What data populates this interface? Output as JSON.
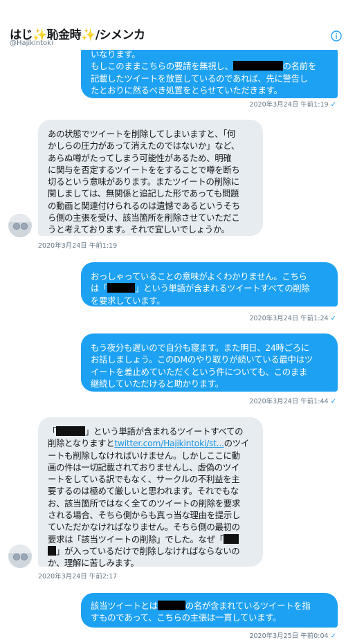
{
  "header": {
    "title": "はじ✨恥金時✨/シメンカ",
    "handle": "@Hajikintoki",
    "info_icon": "info-icon"
  },
  "messages": [
    {
      "id": "m1",
      "direction": "out",
      "lines": [
        "いなります。",
        "もしこのままこちらの要請を無視し、",
        "の名前を",
        "記載したツイートを放置しているのであれば、先に警告し",
        "たとおりに然るべき処置をとらせていただきます。"
      ],
      "timestamp": "2020年3月24日 午前1:19",
      "read_icon": "check-icon"
    },
    {
      "id": "m2",
      "direction": "in",
      "lines": [
        "あの状態でツイートを削除してしまいますと、「何",
        "かしらの圧力があって消えたのではないか」など、",
        "あらぬ噂がたってしまう可能性があるため、明確",
        "に関与を否定するツイートををすることで噂を断ち",
        "切るという意味があります。またツイートの削除に",
        "関しましては、無関係と追記した形であっても問題",
        "の動画と関連付けられるのは遺憾であるというそち",
        "ら側の主張を受け、該当箇所を削除させていただこ",
        "うと考えております。それで宜しいでしょうか。"
      ],
      "timestamp": "2020年3月24日 午前1:19"
    },
    {
      "id": "m3",
      "direction": "out",
      "lines": [
        "おっしゃっていることの意味がよくわかりません。こちら",
        "は「",
        "」という単語が含まれるツイートすべての削除",
        "を要求しています。"
      ],
      "timestamp": "2020年3月24日 午前1:24",
      "read_icon": "check-icon"
    },
    {
      "id": "m4",
      "direction": "out",
      "lines": [
        "もう夜分も遅いので自分も寝ます。また明日、24時ごろに",
        "お話しましょう。このDMのやり取りが続いている最中はツ",
        "イートを差止めていただくという件についても、このまま",
        "継続していただけると助かります。"
      ],
      "timestamp": "2020年3月24日 午前1:44",
      "read_icon": "check-icon"
    },
    {
      "id": "m5",
      "direction": "in",
      "lines": [
        "「",
        "」という単語が含まれるツイートすべての",
        "削除となりますと",
        "twitter.com/Hajikintoki/st...",
        "のツイ",
        "ートも削除しなければいけません。しかしここに動",
        "画の件は一切記載されておりませんし、虚偽のツイ",
        "ートをしている訳でもなく、サークルの不利益を主",
        "要するのは極めて厳しいと思われます。それでもな",
        "お、該当箇所ではなく全てのツイートの削除を要求",
        "される場合、そちら側からも真っ当な理由を提示し",
        "ていただかなければなりません。そちら側の最初の",
        "要求は「該当ツイートの削除」でした。なぜ「",
        "」が入っているだけで削除しなければならないの",
        "か、理解に苦しみます。"
      ],
      "timestamp": "2020年3月24日 午前2:17"
    },
    {
      "id": "m6",
      "direction": "out",
      "lines": [
        "該当ツイートとは",
        "の名が含まれているツイートを指",
        "すものであって、こちらの主張は一貫しています。"
      ],
      "timestamp": "2020年3月25日 午前0:04",
      "read_icon": "check-icon"
    }
  ]
}
